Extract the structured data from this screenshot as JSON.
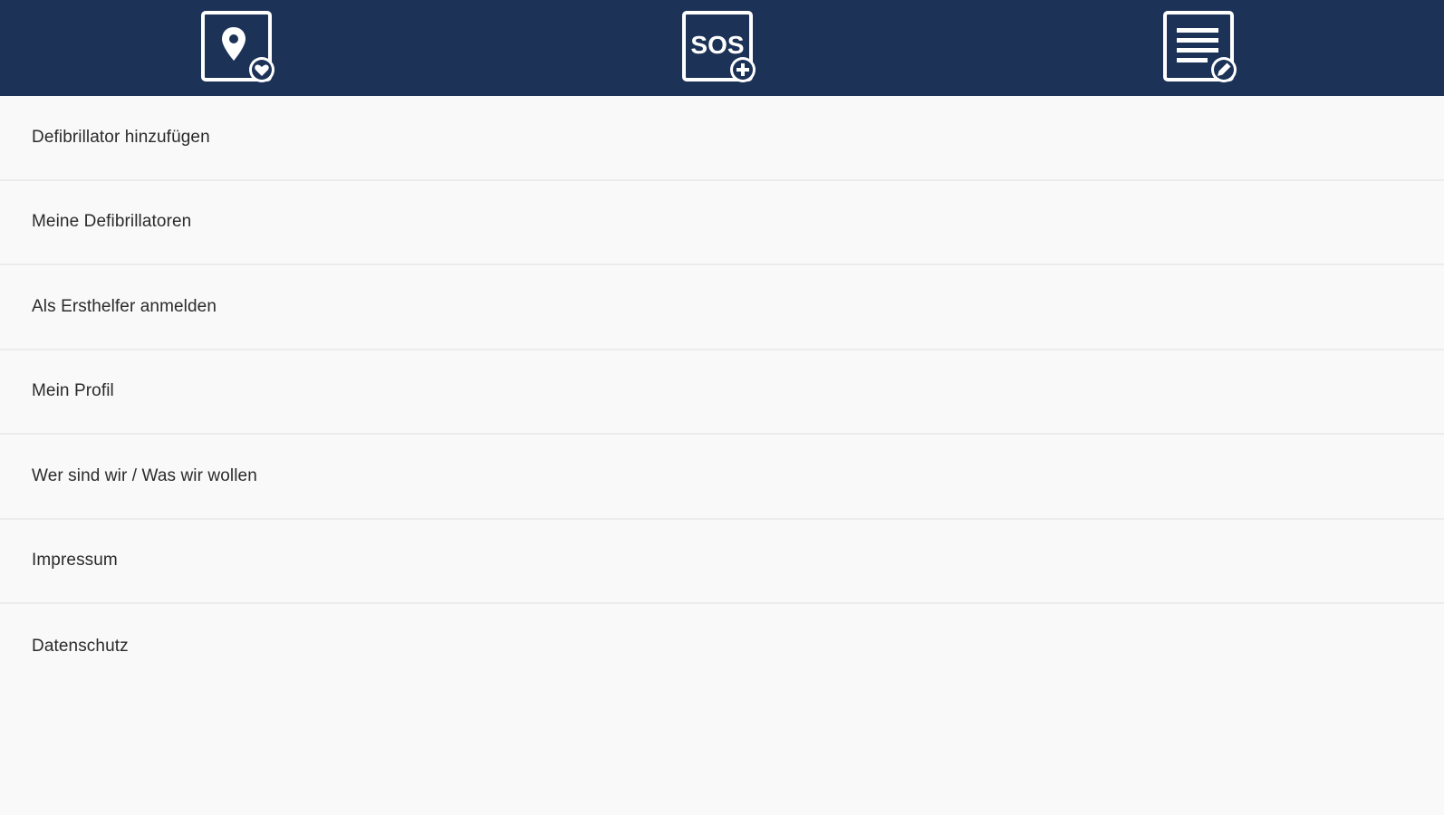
{
  "colors": {
    "topbar_bg": "#1c3257",
    "icon_fg": "#ffffff",
    "page_bg": "#f9f9f9",
    "divider": "#ececec",
    "text": "#2b2b2b"
  },
  "topbar": {
    "tabs": [
      {
        "icon": "map-pin-heart-icon"
      },
      {
        "icon": "sos-plus-icon",
        "text": "SOS"
      },
      {
        "icon": "document-edit-icon"
      }
    ]
  },
  "menu": {
    "items": [
      {
        "label": "Defibrillator hinzufügen"
      },
      {
        "label": "Meine Defibrillatoren"
      },
      {
        "label": "Als Ersthelfer anmelden"
      },
      {
        "label": "Mein Profil"
      },
      {
        "label": "Wer sind wir / Was wir wollen"
      },
      {
        "label": "Impressum"
      },
      {
        "label": "Datenschutz"
      }
    ]
  }
}
